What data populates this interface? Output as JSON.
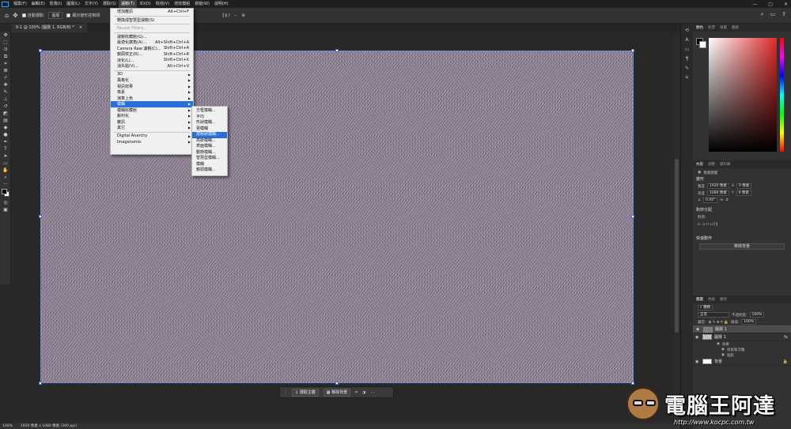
{
  "menubar": {
    "items": [
      "檔案(F)",
      "編輯(E)",
      "影像(I)",
      "圖層(L)",
      "文字(Y)",
      "選取(S)",
      "濾鏡(T)",
      "3D(D)",
      "檢視(V)",
      "增效模組",
      "視窗(W)",
      "說明(H)"
    ],
    "active_index": 6
  },
  "optbar": {
    "auto_select_label": "自動選取:",
    "auto_select_value": "圖層",
    "transform_label": "顯示變形控制項",
    "more_label": "···"
  },
  "doc_tab": {
    "title": "0-1 @ 100% (圖層 1, RGB/8) *",
    "close": "×"
  },
  "filter_menu": {
    "items": [
      {
        "label": "增加雜訊",
        "shortcut": "Alt+Ctrl+F",
        "type": "item"
      },
      {
        "type": "sep"
      },
      {
        "label": "轉換成智慧型濾鏡(S)",
        "shortcut": "",
        "type": "item"
      },
      {
        "type": "sep"
      },
      {
        "label": "Neural Filters...",
        "shortcut": "",
        "type": "disabled"
      },
      {
        "type": "sep"
      },
      {
        "label": "濾鏡收藏館(G)...",
        "shortcut": "",
        "type": "item"
      },
      {
        "label": "最適化廣角(A)...",
        "shortcut": "Alt+Shift+Ctrl+A",
        "type": "item"
      },
      {
        "label": "Camera Raw 濾鏡(C)...",
        "shortcut": "Shift+Ctrl+A",
        "type": "item"
      },
      {
        "label": "鏡頭校正(R)...",
        "shortcut": "Shift+Ctrl+R",
        "type": "item"
      },
      {
        "label": "液化(L)...",
        "shortcut": "Shift+Ctrl+X",
        "type": "item"
      },
      {
        "label": "消失點(V)...",
        "shortcut": "Alt+Ctrl+V",
        "type": "item"
      },
      {
        "type": "sep"
      },
      {
        "label": "3D",
        "shortcut": "",
        "type": "sub"
      },
      {
        "label": "風格化",
        "shortcut": "",
        "type": "sub"
      },
      {
        "label": "視訊效果",
        "shortcut": "",
        "type": "sub"
      },
      {
        "label": "像素",
        "shortcut": "",
        "type": "sub"
      },
      {
        "label": "演算上色",
        "shortcut": "",
        "type": "sub"
      },
      {
        "label": "模糊",
        "shortcut": "",
        "type": "sub-hl"
      },
      {
        "label": "模糊收藏館",
        "shortcut": "",
        "type": "sub"
      },
      {
        "label": "銳利化",
        "shortcut": "",
        "type": "sub"
      },
      {
        "label": "雜訊",
        "shortcut": "",
        "type": "sub"
      },
      {
        "label": "其它",
        "shortcut": "",
        "type": "sub"
      },
      {
        "type": "sep"
      },
      {
        "label": "Digital Anarchy",
        "shortcut": "",
        "type": "sub"
      },
      {
        "label": "Imagenomic",
        "shortcut": "",
        "type": "sub"
      }
    ]
  },
  "blur_submenu": {
    "items": [
      "方框模糊...",
      "平均",
      "形狀模糊...",
      "更模糊",
      "放射狀模糊...",
      "高斯模糊...",
      "表面模糊...",
      "動態模糊...",
      "智慧型模糊...",
      "模糊",
      "鏡頭模糊..."
    ],
    "highlight_index": 4
  },
  "contextual_bar": {
    "btn1": "選取主體",
    "btn2": "移除背景",
    "more": "···"
  },
  "status": {
    "zoom": "100%",
    "size": "1920 像素 x 1080 像素 (300 ppi)"
  },
  "color_panel": {
    "tabs": [
      "顏色",
      "色票",
      "漸層",
      "圖樣"
    ]
  },
  "properties": {
    "tabs": [
      "內容",
      "調整",
      "資料庫"
    ],
    "layer_type": "像素圖層",
    "transform_title": "變形",
    "width_label": "寬度",
    "width_value": "1920 像素",
    "height_label": "高度",
    "height_value": "1080 像素",
    "x_label": "X",
    "x_value": "0 像素",
    "y_label": "Y",
    "y_value": "0 像素",
    "angle_value": "0.00°",
    "align_title": "對齊分配",
    "align_label": "對齊:",
    "quick_title": "快速動作",
    "remove_bg": "移除背景"
  },
  "layers_panel": {
    "tabs": [
      "圖層",
      "色版",
      "路徑"
    ],
    "filter_label": "種類",
    "blend_mode": "正常",
    "opacity_label": "不透明度:",
    "opacity_value": "100%",
    "lock_label": "鎖定:",
    "fill_label": "填滿:",
    "fill_value": "100%",
    "layers": [
      {
        "name": "圖層 1",
        "selected": true
      },
      {
        "name": "圖層 1",
        "selected": false,
        "fx": "fx"
      },
      {
        "name": "背景",
        "selected": false
      }
    ],
    "effects": [
      "效果",
      "斜角和浮雕",
      "陰影"
    ]
  },
  "watermark": {
    "title": "電腦王阿達",
    "url": "http://www.kocpc.com.tw"
  },
  "colors": {
    "accent": "#2a6fd5",
    "panel_bg": "#323232",
    "canvas_border": "#6a8bd8"
  }
}
